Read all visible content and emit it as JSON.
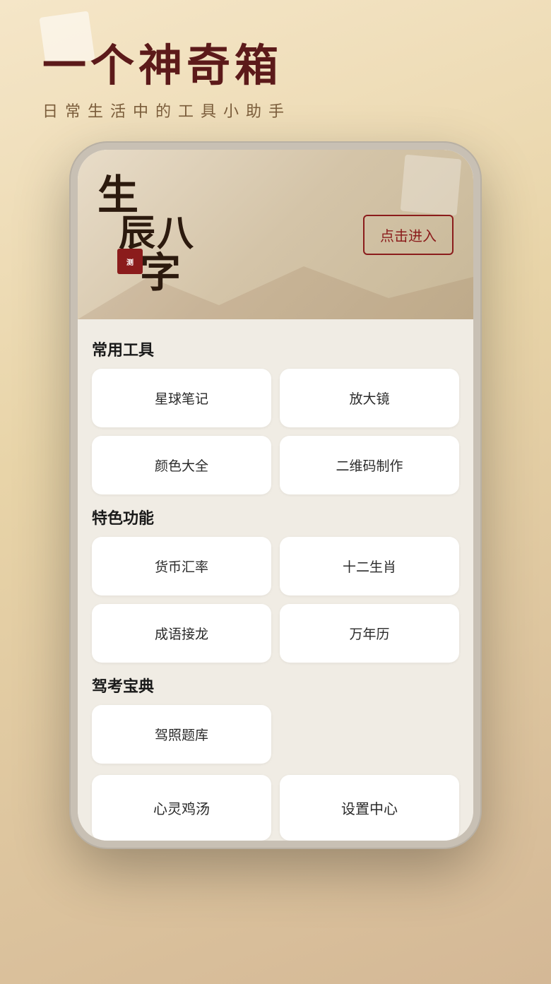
{
  "background": {
    "color": "#e8d4a8"
  },
  "header": {
    "main_title": "一个神奇箱",
    "sub_title": "日常生活中的工具小助手"
  },
  "banner": {
    "title_line1": "生",
    "title_line2": "辰八",
    "title_line3": "字",
    "seal_text": "测",
    "enter_button": "点击进入"
  },
  "sections": [
    {
      "title": "常用工具",
      "tools": [
        {
          "label": "星球笔记"
        },
        {
          "label": "放大镜"
        },
        {
          "label": "颜色大全"
        },
        {
          "label": "二维码制作"
        }
      ]
    },
    {
      "title": "特色功能",
      "tools": [
        {
          "label": "货币汇率"
        },
        {
          "label": "十二生肖"
        },
        {
          "label": "成语接龙"
        },
        {
          "label": "万年历"
        }
      ]
    },
    {
      "title": "驾考宝典",
      "tools": [
        {
          "label": "驾照题库"
        }
      ]
    }
  ],
  "bottom_row": [
    {
      "label": "心灵鸡汤"
    },
    {
      "label": "设置中心"
    }
  ]
}
